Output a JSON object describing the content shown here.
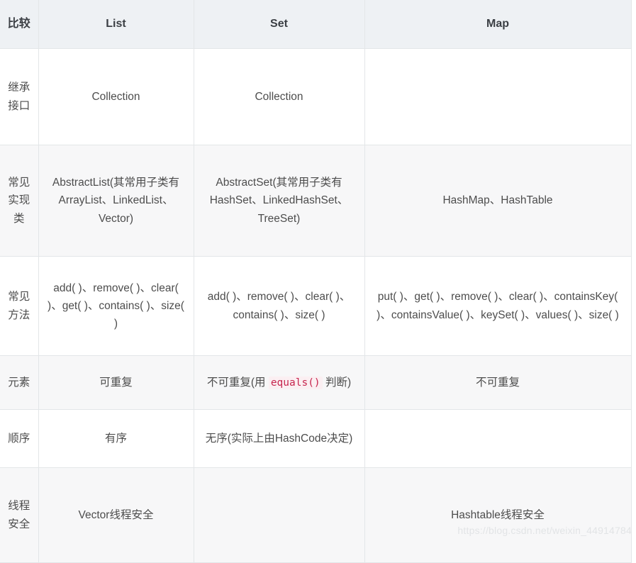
{
  "table": {
    "columns": [
      "比较",
      "List",
      "Set",
      "Map"
    ],
    "rows": [
      {
        "label": "继承接口",
        "list": "Collection",
        "set": "Collection",
        "map": ""
      },
      {
        "label": "常见实现类",
        "list": "AbstractList(其常用子类有ArrayList、LinkedList、Vector)",
        "set": "AbstractSet(其常用子类有HashSet、LinkedHashSet、TreeSet)",
        "map": "HashMap、HashTable"
      },
      {
        "label": "常见方法",
        "list": "add( )、remove( )、clear( )、get( )、contains( )、size( )",
        "set": "add( )、remove( )、clear( )、contains( )、size( )",
        "map": "put( )、get( )、remove( )、clear( )、containsKey( )、containsValue( )、keySet( )、values( )、size( )"
      },
      {
        "label": "元素",
        "list": "可重复",
        "set_prefix": "不可重复(用 ",
        "set_code": "equals()",
        "set_suffix": " 判断)",
        "map": "不可重复"
      },
      {
        "label": "顺序",
        "list": "有序",
        "set": "无序(实际上由HashCode决定)",
        "map": ""
      },
      {
        "label": "线程安全",
        "list": "Vector线程安全",
        "set": "",
        "map": "Hashtable线程安全"
      }
    ]
  },
  "watermark": {
    "text": "https://blog.csdn.net/weixin_44914784"
  },
  "colors": {
    "header_bg": "#eef1f4",
    "border": "#e3e6e8",
    "text": "#4d4d4d",
    "stripe_bg": "#f7f7f8",
    "code_text": "#c7254e",
    "code_bg": "#fbeff2",
    "watermark": "#e2e4e6"
  }
}
